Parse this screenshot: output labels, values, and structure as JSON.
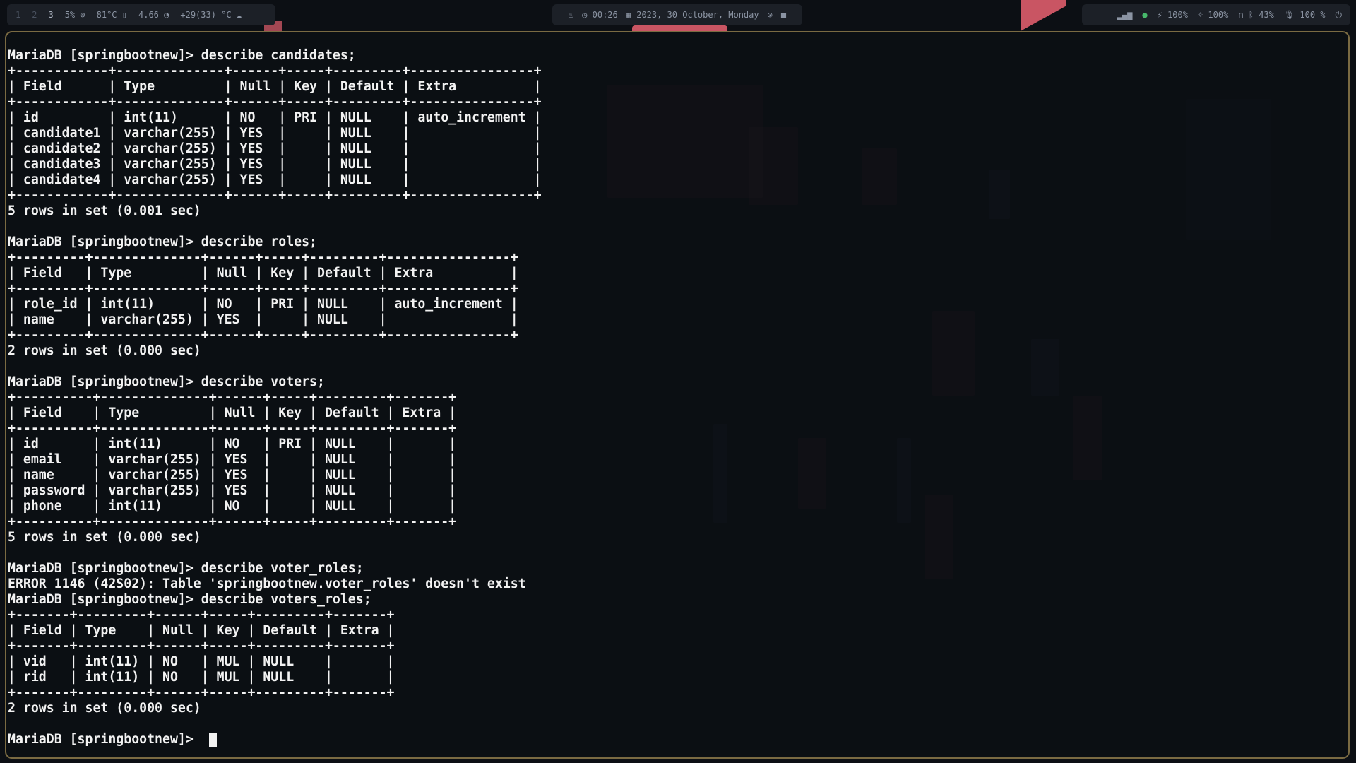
{
  "topbar": {
    "workspaces": [
      "1",
      "2",
      "3"
    ],
    "cpu": "5%",
    "temp": "81°C",
    "load": "4.66",
    "weather": "+29(33) °C",
    "time": "00:26",
    "date": "2023, 30 October, Monday",
    "volume": "100%",
    "brightness": "100%",
    "battery": "43%",
    "mic": "100 %"
  },
  "terminal": {
    "lines": [
      "MariaDB [springbootnew]> describe candidates;",
      "+------------+--------------+------+-----+---------+----------------+",
      "| Field      | Type         | Null | Key | Default | Extra          |",
      "+------------+--------------+------+-----+---------+----------------+",
      "| id         | int(11)      | NO   | PRI | NULL    | auto_increment |",
      "| candidate1 | varchar(255) | YES  |     | NULL    |                |",
      "| candidate2 | varchar(255) | YES  |     | NULL    |                |",
      "| candidate3 | varchar(255) | YES  |     | NULL    |                |",
      "| candidate4 | varchar(255) | YES  |     | NULL    |                |",
      "+------------+--------------+------+-----+---------+----------------+",
      "5 rows in set (0.001 sec)",
      "",
      "MariaDB [springbootnew]> describe roles;",
      "+---------+--------------+------+-----+---------+----------------+",
      "| Field   | Type         | Null | Key | Default | Extra          |",
      "+---------+--------------+------+-----+---------+----------------+",
      "| role_id | int(11)      | NO   | PRI | NULL    | auto_increment |",
      "| name    | varchar(255) | YES  |     | NULL    |                |",
      "+---------+--------------+------+-----+---------+----------------+",
      "2 rows in set (0.000 sec)",
      "",
      "MariaDB [springbootnew]> describe voters;",
      "+----------+--------------+------+-----+---------+-------+",
      "| Field    | Type         | Null | Key | Default | Extra |",
      "+----------+--------------+------+-----+---------+-------+",
      "| id       | int(11)      | NO   | PRI | NULL    |       |",
      "| email    | varchar(255) | YES  |     | NULL    |       |",
      "| name     | varchar(255) | YES  |     | NULL    |       |",
      "| password | varchar(255) | YES  |     | NULL    |       |",
      "| phone    | int(11)      | NO   |     | NULL    |       |",
      "+----------+--------------+------+-----+---------+-------+",
      "5 rows in set (0.000 sec)",
      "",
      "MariaDB [springbootnew]> describe voter_roles;",
      "ERROR 1146 (42S02): Table 'springbootnew.voter_roles' doesn't exist",
      "MariaDB [springbootnew]> describe voters_roles;",
      "+-------+---------+------+-----+---------+-------+",
      "| Field | Type    | Null | Key | Default | Extra |",
      "+-------+---------+------+-----+---------+-------+",
      "| vid   | int(11) | NO   | MUL | NULL    |       |",
      "| rid   | int(11) | NO   | MUL | NULL    |       |",
      "+-------+---------+------+-----+---------+-------+",
      "2 rows in set (0.000 sec)",
      ""
    ],
    "prompt": "MariaDB [springbootnew]> "
  },
  "colors": {
    "accent": "#c95563",
    "text": "#f2f2f2",
    "border": "#7a6a42",
    "bar_bg": "#1c2027"
  },
  "icons": [
    "cpu-icon",
    "thermometer-icon",
    "load-icon",
    "weather-icon",
    "flame-icon",
    "clock-icon",
    "calendar-icon",
    "settings-icon",
    "lock-icon",
    "signal-icon",
    "status-dot-icon",
    "volume-icon",
    "brightness-icon",
    "headphones-icon",
    "bluetooth-icon",
    "mic-icon",
    "power-icon"
  ]
}
